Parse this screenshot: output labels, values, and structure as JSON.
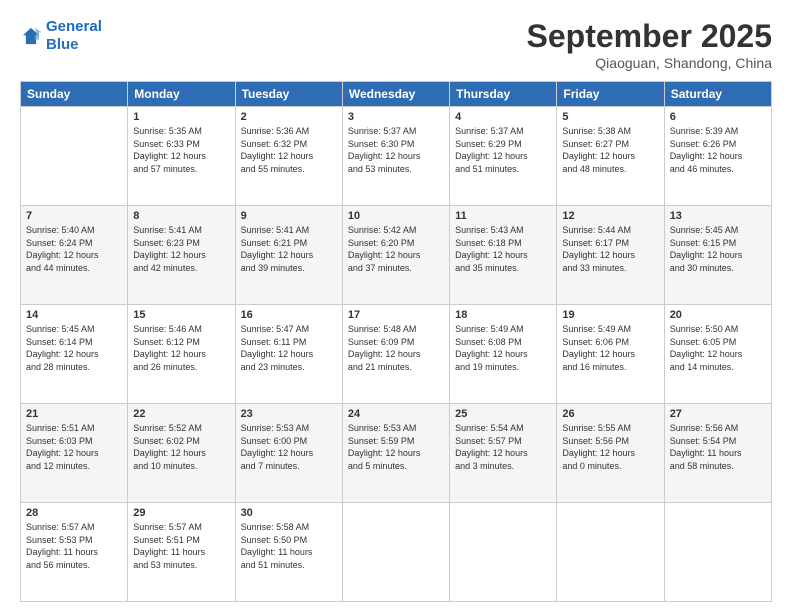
{
  "header": {
    "logo_line1": "General",
    "logo_line2": "Blue",
    "month": "September 2025",
    "location": "Qiaoguan, Shandong, China"
  },
  "days_of_week": [
    "Sunday",
    "Monday",
    "Tuesday",
    "Wednesday",
    "Thursday",
    "Friday",
    "Saturday"
  ],
  "weeks": [
    [
      {
        "day": "",
        "info": ""
      },
      {
        "day": "1",
        "info": "Sunrise: 5:35 AM\nSunset: 6:33 PM\nDaylight: 12 hours\nand 57 minutes."
      },
      {
        "day": "2",
        "info": "Sunrise: 5:36 AM\nSunset: 6:32 PM\nDaylight: 12 hours\nand 55 minutes."
      },
      {
        "day": "3",
        "info": "Sunrise: 5:37 AM\nSunset: 6:30 PM\nDaylight: 12 hours\nand 53 minutes."
      },
      {
        "day": "4",
        "info": "Sunrise: 5:37 AM\nSunset: 6:29 PM\nDaylight: 12 hours\nand 51 minutes."
      },
      {
        "day": "5",
        "info": "Sunrise: 5:38 AM\nSunset: 6:27 PM\nDaylight: 12 hours\nand 48 minutes."
      },
      {
        "day": "6",
        "info": "Sunrise: 5:39 AM\nSunset: 6:26 PM\nDaylight: 12 hours\nand 46 minutes."
      }
    ],
    [
      {
        "day": "7",
        "info": "Sunrise: 5:40 AM\nSunset: 6:24 PM\nDaylight: 12 hours\nand 44 minutes."
      },
      {
        "day": "8",
        "info": "Sunrise: 5:41 AM\nSunset: 6:23 PM\nDaylight: 12 hours\nand 42 minutes."
      },
      {
        "day": "9",
        "info": "Sunrise: 5:41 AM\nSunset: 6:21 PM\nDaylight: 12 hours\nand 39 minutes."
      },
      {
        "day": "10",
        "info": "Sunrise: 5:42 AM\nSunset: 6:20 PM\nDaylight: 12 hours\nand 37 minutes."
      },
      {
        "day": "11",
        "info": "Sunrise: 5:43 AM\nSunset: 6:18 PM\nDaylight: 12 hours\nand 35 minutes."
      },
      {
        "day": "12",
        "info": "Sunrise: 5:44 AM\nSunset: 6:17 PM\nDaylight: 12 hours\nand 33 minutes."
      },
      {
        "day": "13",
        "info": "Sunrise: 5:45 AM\nSunset: 6:15 PM\nDaylight: 12 hours\nand 30 minutes."
      }
    ],
    [
      {
        "day": "14",
        "info": "Sunrise: 5:45 AM\nSunset: 6:14 PM\nDaylight: 12 hours\nand 28 minutes."
      },
      {
        "day": "15",
        "info": "Sunrise: 5:46 AM\nSunset: 6:12 PM\nDaylight: 12 hours\nand 26 minutes."
      },
      {
        "day": "16",
        "info": "Sunrise: 5:47 AM\nSunset: 6:11 PM\nDaylight: 12 hours\nand 23 minutes."
      },
      {
        "day": "17",
        "info": "Sunrise: 5:48 AM\nSunset: 6:09 PM\nDaylight: 12 hours\nand 21 minutes."
      },
      {
        "day": "18",
        "info": "Sunrise: 5:49 AM\nSunset: 6:08 PM\nDaylight: 12 hours\nand 19 minutes."
      },
      {
        "day": "19",
        "info": "Sunrise: 5:49 AM\nSunset: 6:06 PM\nDaylight: 12 hours\nand 16 minutes."
      },
      {
        "day": "20",
        "info": "Sunrise: 5:50 AM\nSunset: 6:05 PM\nDaylight: 12 hours\nand 14 minutes."
      }
    ],
    [
      {
        "day": "21",
        "info": "Sunrise: 5:51 AM\nSunset: 6:03 PM\nDaylight: 12 hours\nand 12 minutes."
      },
      {
        "day": "22",
        "info": "Sunrise: 5:52 AM\nSunset: 6:02 PM\nDaylight: 12 hours\nand 10 minutes."
      },
      {
        "day": "23",
        "info": "Sunrise: 5:53 AM\nSunset: 6:00 PM\nDaylight: 12 hours\nand 7 minutes."
      },
      {
        "day": "24",
        "info": "Sunrise: 5:53 AM\nSunset: 5:59 PM\nDaylight: 12 hours\nand 5 minutes."
      },
      {
        "day": "25",
        "info": "Sunrise: 5:54 AM\nSunset: 5:57 PM\nDaylight: 12 hours\nand 3 minutes."
      },
      {
        "day": "26",
        "info": "Sunrise: 5:55 AM\nSunset: 5:56 PM\nDaylight: 12 hours\nand 0 minutes."
      },
      {
        "day": "27",
        "info": "Sunrise: 5:56 AM\nSunset: 5:54 PM\nDaylight: 11 hours\nand 58 minutes."
      }
    ],
    [
      {
        "day": "28",
        "info": "Sunrise: 5:57 AM\nSunset: 5:53 PM\nDaylight: 11 hours\nand 56 minutes."
      },
      {
        "day": "29",
        "info": "Sunrise: 5:57 AM\nSunset: 5:51 PM\nDaylight: 11 hours\nand 53 minutes."
      },
      {
        "day": "30",
        "info": "Sunrise: 5:58 AM\nSunset: 5:50 PM\nDaylight: 11 hours\nand 51 minutes."
      },
      {
        "day": "",
        "info": ""
      },
      {
        "day": "",
        "info": ""
      },
      {
        "day": "",
        "info": ""
      },
      {
        "day": "",
        "info": ""
      }
    ]
  ]
}
